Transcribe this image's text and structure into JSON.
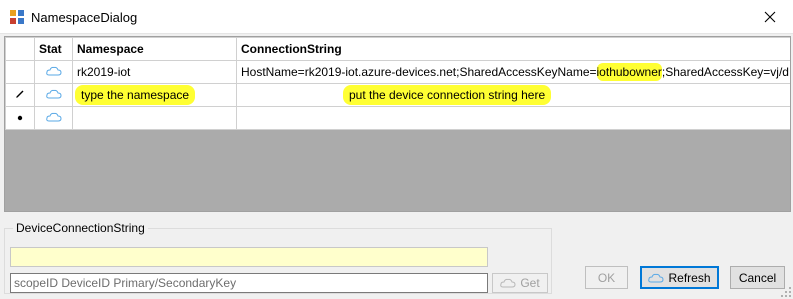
{
  "window": {
    "title": "NamespaceDialog"
  },
  "grid": {
    "columns": {
      "stat": "Stat",
      "namespace": "Namespace",
      "connection": "ConnectionString"
    },
    "rows": [
      {
        "namespace": "rk2019-iot",
        "conn_before": "HostName=rk2019-iot.azure-devices.net;SharedAccessKeyName=",
        "conn_highlight": "iothubowner",
        "conn_after": ";SharedAccessKey=vj/d..."
      },
      {
        "namespace_hint": "type the namespace",
        "conn_hint": "put the device connection string here"
      },
      {
        "namespace": "",
        "conn": ""
      }
    ],
    "row_markers": {
      "editing": "pencil-icon",
      "new": "asterisk-icon"
    }
  },
  "device_group": {
    "legend": "DeviceConnectionString",
    "device_value": "",
    "scope_placeholder": "scopeID DeviceID Primary/SecondaryKey",
    "get_label": "Get"
  },
  "buttons": {
    "ok": "OK",
    "refresh": "Refresh",
    "cancel": "Cancel"
  },
  "colors": {
    "highlight": "#ffff33",
    "field_yellow": "#ffffcc",
    "accent": "#0078d7"
  }
}
